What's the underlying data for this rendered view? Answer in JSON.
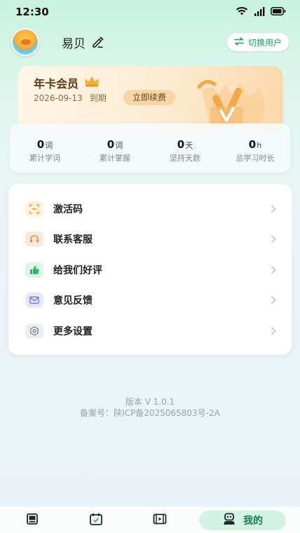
{
  "status_bar": {
    "time": "12:30"
  },
  "profile": {
    "username": "易贝",
    "switch_user_label": "切换用户"
  },
  "vip": {
    "title": "年卡会员",
    "expire_date": "2026-09-13",
    "expire_suffix": "到期",
    "renew_label": "立即续费"
  },
  "stats": [
    {
      "value": "0",
      "unit": "词",
      "label": "累计学词"
    },
    {
      "value": "0",
      "unit": "词",
      "label": "累计掌握"
    },
    {
      "value": "0",
      "unit": "天",
      "label": "坚持天数"
    },
    {
      "value": "0",
      "unit": "h",
      "label": "总学习时长"
    }
  ],
  "menu": [
    {
      "label": "激活码",
      "icon": "scan-code-icon",
      "color": "#f2a53a",
      "bg": "#fdf2dc"
    },
    {
      "label": "联系客服",
      "icon": "headset-icon",
      "color": "#ef8a4a",
      "bg": "#fde9dc"
    },
    {
      "label": "给我们好评",
      "icon": "thumbs-up-icon",
      "color": "#2fb46f",
      "bg": "#dcf5e6"
    },
    {
      "label": "意见反馈",
      "icon": "mail-icon",
      "color": "#7d7fdc",
      "bg": "#e8e8fa"
    },
    {
      "label": "更多设置",
      "icon": "gear-icon",
      "color": "#8a8f99",
      "bg": "#eceef1"
    }
  ],
  "footer": {
    "version": "版本 V 1.0.1",
    "beian": "备案号：陕ICP备2025065803号-2A"
  },
  "tabbar": {
    "active_label": "我的",
    "accent": "#167e56"
  }
}
